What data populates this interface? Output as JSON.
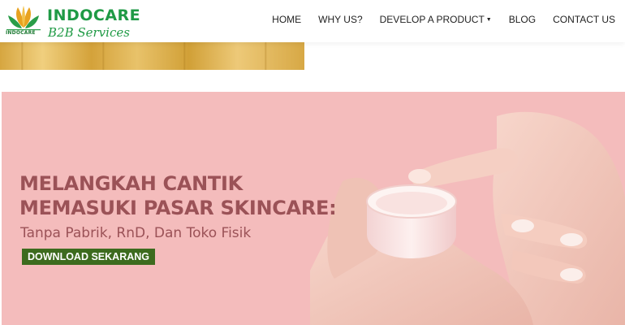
{
  "logo": {
    "name": "INDOCARE",
    "tagline": "B2B Services",
    "mark_label": "INDOCARE"
  },
  "nav": {
    "items": [
      {
        "label": "HOME"
      },
      {
        "label": "WHY US?"
      },
      {
        "label": "DEVELOP A PRODUCT",
        "has_dropdown": true
      },
      {
        "label": "BLOG"
      },
      {
        "label": "CONTACT US"
      }
    ]
  },
  "hero": {
    "title_line1": "MELANGKAH CANTIK",
    "title_line2": "MEMASUKI PASAR SKINCARE:",
    "subtitle": "Tanpa Pabrik, RnD, Dan Toko Fisik",
    "cta_label": "DOWNLOAD SEKARANG"
  },
  "colors": {
    "brand_green": "#1f9a45",
    "hero_background": "#f4bcbc",
    "hero_text": "#9b5257",
    "cta_background": "#3d6b1e",
    "gold": "#d6a640"
  },
  "icons": {
    "nav_dropdown": "caret-down-icon",
    "logo": "leaf-logo-icon"
  }
}
